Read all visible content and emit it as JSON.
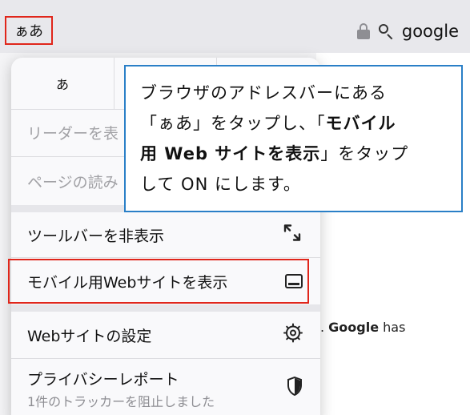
{
  "address_bar": {
    "aa_label": "ぁあ",
    "site": "google",
    "lock_icon": "lock-icon",
    "search_icon": "search-icon"
  },
  "menu": {
    "font_small_label": "あ",
    "items": [
      {
        "label": "リーダーを表",
        "enabled": false
      },
      {
        "label": "ページの読み",
        "enabled": false
      },
      {
        "label": "ツールバーを非表示",
        "icon": "resize-icon"
      },
      {
        "label": "モバイル用Webサイトを表示",
        "icon": "phone-icon",
        "highlighted": true
      },
      {
        "label": "Webサイトの設定",
        "icon": "gear-icon"
      },
      {
        "label": "プライバシーレポート",
        "sub": "1件のトラッカーを阻止しました",
        "icon": "shield-icon"
      }
    ]
  },
  "page": {
    "fragment_prefix": ". ",
    "fragment_bold": "Google",
    "fragment_suffix": " has"
  },
  "callout": {
    "line1": "ブラウザのアドレスバーにある",
    "line2_a": "「ぁあ」をタップし、「",
    "line2_bold": "モバイル",
    "line3_bold": "用 Web サイトを表示",
    "line3_b": "」をタップ",
    "line4": "して ON にします。"
  },
  "colors": {
    "highlight": "#e0261b",
    "callout_border": "#2a7fc7"
  }
}
